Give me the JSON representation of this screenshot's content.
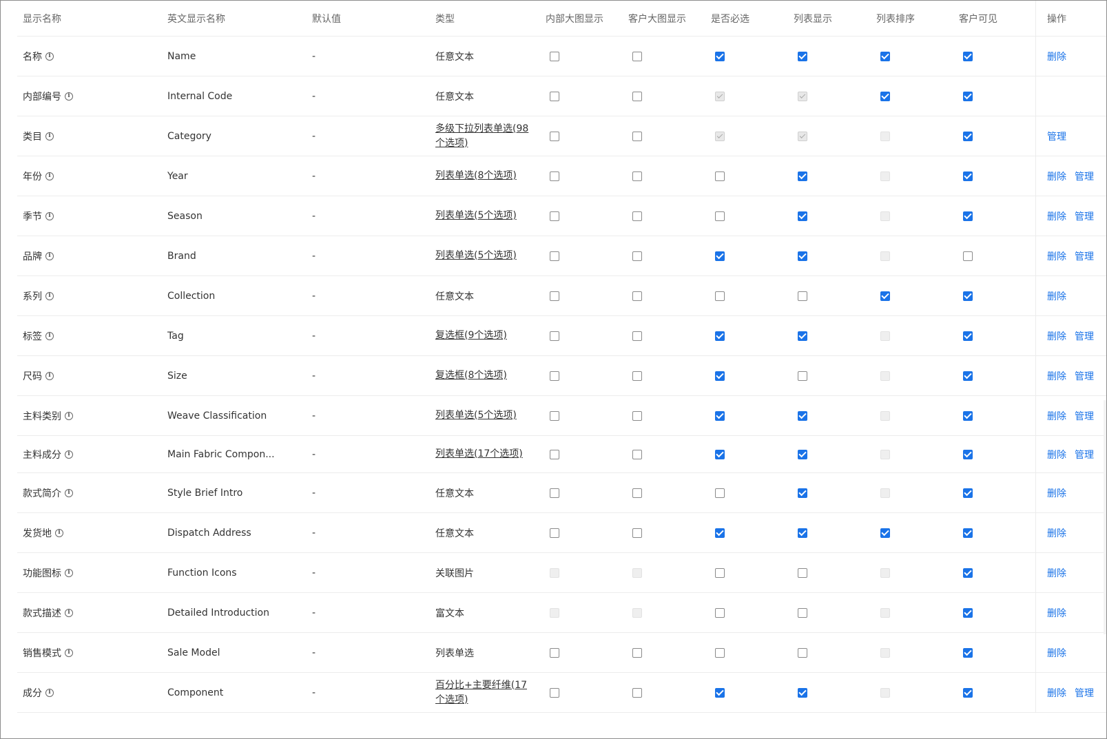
{
  "headers": {
    "name": "显示名称",
    "en": "英文显示名称",
    "default": "默认值",
    "type": "类型",
    "cb": [
      "内部大图显示",
      "客户大图显示",
      "是否必选",
      "列表显示",
      "列表排序",
      "客户可见"
    ],
    "ops": "操作"
  },
  "ops_labels": {
    "delete": "删除",
    "manage": "管理"
  },
  "checkbox_states_legend": {
    "on": "checked",
    "off": "unchecked",
    "dis_on": "disabled-checked",
    "dis": "disabled"
  },
  "rows": [
    {
      "name": "名称",
      "en": "Name",
      "default": "-",
      "type": "任意文本",
      "type_link": false,
      "cb": [
        "off",
        "off",
        "on",
        "on",
        "on",
        "on"
      ],
      "ops": [
        "delete"
      ]
    },
    {
      "name": "内部编号",
      "en": "Internal Code",
      "default": "-",
      "type": "任意文本",
      "type_link": false,
      "cb": [
        "off",
        "off",
        "dis_on",
        "dis_on",
        "on",
        "on"
      ],
      "ops": []
    },
    {
      "name": "类目",
      "en": "Category",
      "default": "-",
      "type": "多级下拉列表单选(98个选项)",
      "type_link": true,
      "cb": [
        "off",
        "off",
        "dis_on",
        "dis_on",
        "dis",
        "on"
      ],
      "ops": [
        "manage"
      ]
    },
    {
      "name": "年份",
      "en": "Year",
      "default": "-",
      "type": "列表单选(8个选项)",
      "type_link": true,
      "cb": [
        "off",
        "off",
        "off",
        "on",
        "dis",
        "on"
      ],
      "ops": [
        "delete",
        "manage"
      ]
    },
    {
      "name": "季节",
      "en": "Season",
      "default": "-",
      "type": "列表单选(5个选项)",
      "type_link": true,
      "cb": [
        "off",
        "off",
        "off",
        "on",
        "dis",
        "on"
      ],
      "ops": [
        "delete",
        "manage"
      ]
    },
    {
      "name": "品牌",
      "en": "Brand",
      "default": "-",
      "type": "列表单选(5个选项)",
      "type_link": true,
      "cb": [
        "off",
        "off",
        "on",
        "on",
        "dis",
        "off"
      ],
      "ops": [
        "delete",
        "manage"
      ]
    },
    {
      "name": "系列",
      "en": "Collection",
      "default": "-",
      "type": "任意文本",
      "type_link": false,
      "cb": [
        "off",
        "off",
        "off",
        "off",
        "on",
        "on"
      ],
      "ops": [
        "delete"
      ]
    },
    {
      "name": "标签",
      "en": "Tag",
      "default": "-",
      "type": "复选框(9个选项)",
      "type_link": true,
      "cb": [
        "off",
        "off",
        "on",
        "on",
        "dis",
        "on"
      ],
      "ops": [
        "delete",
        "manage"
      ]
    },
    {
      "name": "尺码",
      "en": "Size",
      "default": "-",
      "type": "复选框(8个选项)",
      "type_link": true,
      "cb": [
        "off",
        "off",
        "on",
        "off",
        "dis",
        "on"
      ],
      "ops": [
        "delete",
        "manage"
      ]
    },
    {
      "name": "主料类别",
      "en": "Weave Classification",
      "default": "-",
      "type": "列表单选(5个选项)",
      "type_link": true,
      "cb": [
        "off",
        "off",
        "on",
        "on",
        "dis",
        "on"
      ],
      "ops": [
        "delete",
        "manage"
      ]
    },
    {
      "name": "主料成分",
      "en": "Main Fabric Compon...",
      "default": "-",
      "type": "列表单选(17个选项)",
      "type_link": true,
      "cb": [
        "off",
        "off",
        "on",
        "on",
        "dis",
        "on"
      ],
      "ops": [
        "delete",
        "manage"
      ]
    },
    {
      "name": "款式简介",
      "en": "Style Brief Intro",
      "default": "-",
      "type": "任意文本",
      "type_link": false,
      "cb": [
        "off",
        "off",
        "off",
        "on",
        "dis",
        "on"
      ],
      "ops": [
        "delete"
      ]
    },
    {
      "name": "发货地",
      "en": "Dispatch Address",
      "default": "-",
      "type": "任意文本",
      "type_link": false,
      "cb": [
        "off",
        "off",
        "on",
        "on",
        "on",
        "on"
      ],
      "ops": [
        "delete"
      ]
    },
    {
      "name": "功能图标",
      "en": "Function Icons",
      "default": "-",
      "type": "关联图片",
      "type_link": false,
      "cb": [
        "dis",
        "dis",
        "off",
        "off",
        "dis",
        "on"
      ],
      "ops": [
        "delete"
      ]
    },
    {
      "name": "款式描述",
      "en": "Detailed Introduction",
      "default": "-",
      "type": "富文本",
      "type_link": false,
      "cb": [
        "dis",
        "dis",
        "off",
        "off",
        "dis",
        "on"
      ],
      "ops": [
        "delete"
      ]
    },
    {
      "name": "销售模式",
      "en": "Sale Model",
      "default": "-",
      "type": "列表单选",
      "type_link": false,
      "cb": [
        "off",
        "off",
        "off",
        "off",
        "dis",
        "on"
      ],
      "ops": [
        "delete"
      ]
    },
    {
      "name": "成分",
      "en": "Component",
      "default": "-",
      "type": "百分比+主要纤维(17个选项)",
      "type_link": true,
      "cb": [
        "off",
        "off",
        "on",
        "on",
        "dis",
        "on"
      ],
      "ops": [
        "delete",
        "manage"
      ]
    }
  ]
}
